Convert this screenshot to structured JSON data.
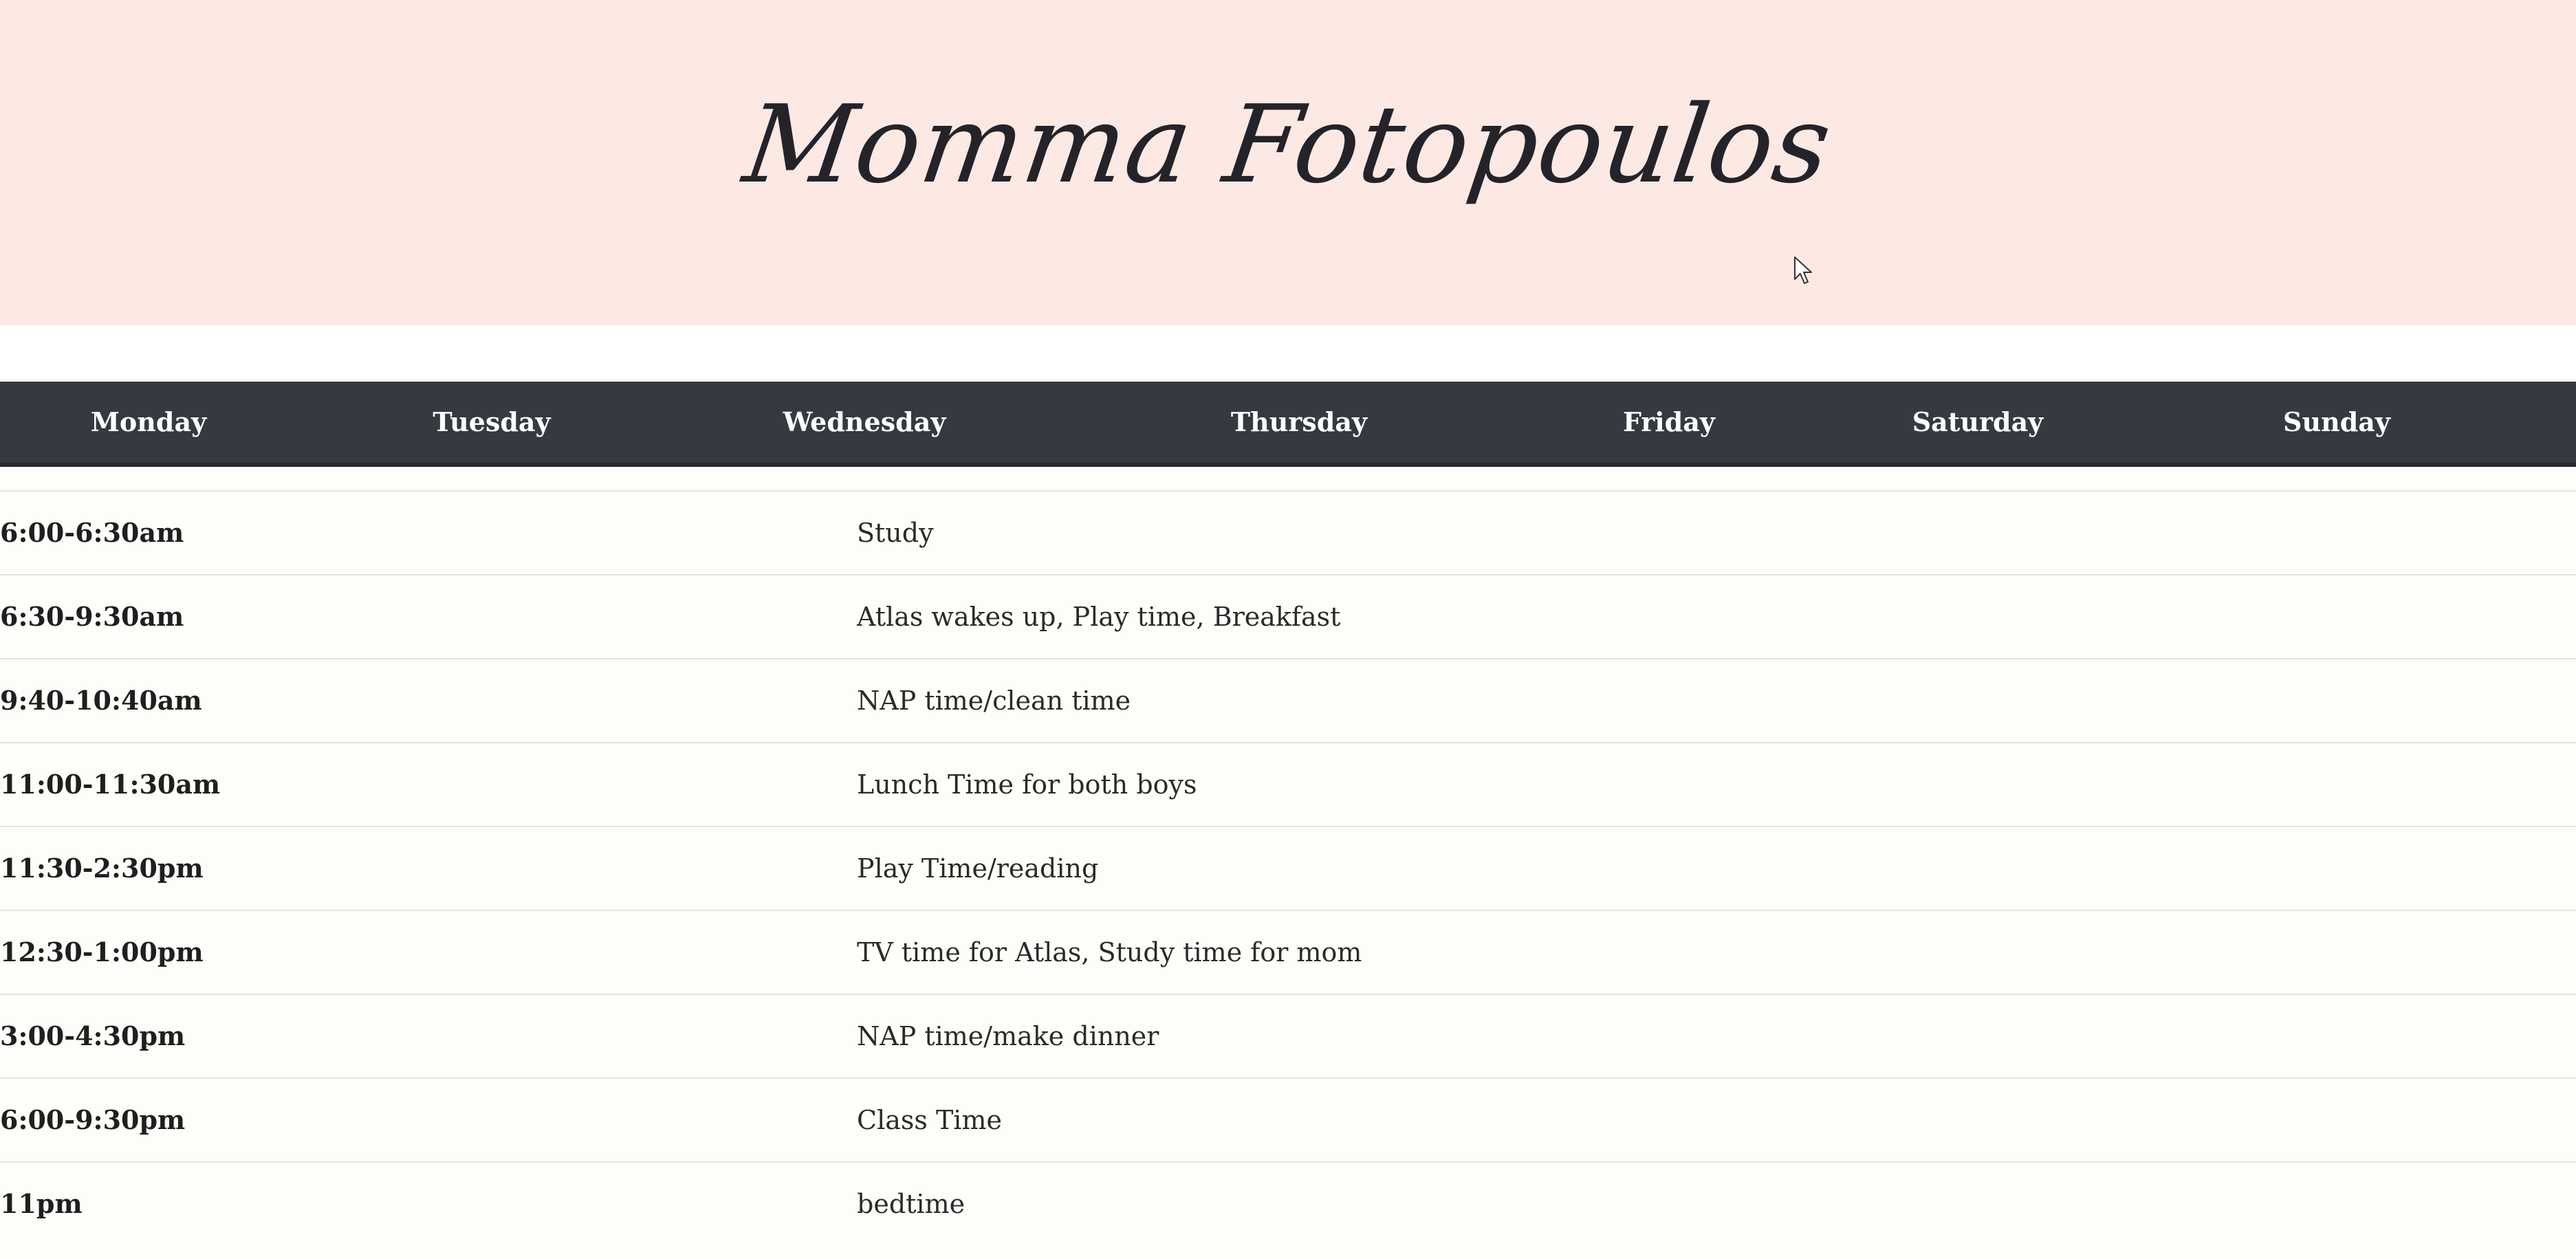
{
  "header": {
    "title": "Momma Fotopoulos",
    "background_color": "#fde9e4"
  },
  "days_bar": {
    "background_color": "#353a40",
    "days": [
      "Monday",
      "Tuesday",
      "Wednesday",
      "Thursday",
      "Friday",
      "Saturday",
      "Sunday"
    ]
  },
  "schedule": {
    "rows": [
      {
        "time": "6:00-6:30am",
        "activity": "Study"
      },
      {
        "time": "6:30-9:30am",
        "activity": "Atlas wakes up, Play time, Breakfast"
      },
      {
        "time": "9:40-10:40am",
        "activity": "NAP time/clean time"
      },
      {
        "time": "11:00-11:30am",
        "activity": "Lunch Time for both boys"
      },
      {
        "time": "11:30-2:30pm",
        "activity": "Play Time/reading"
      },
      {
        "time": "12:30-1:00pm",
        "activity": "TV time for Atlas, Study time for mom"
      },
      {
        "time": "3:00-4:30pm",
        "activity": "NAP time/make dinner"
      },
      {
        "time": "6:00-9:30pm",
        "activity": "Class Time"
      },
      {
        "time": "11pm",
        "activity": "bedtime"
      }
    ]
  },
  "icons": {
    "cursor": "mouse-pointer-icon"
  }
}
